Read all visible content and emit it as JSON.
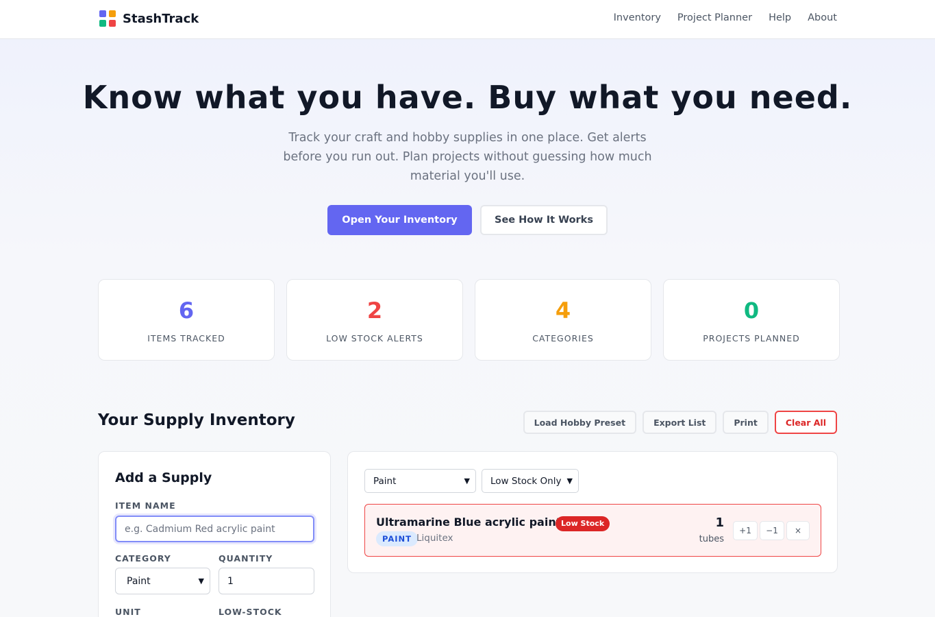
{
  "nav": {
    "brand": "StashTrack",
    "logo_colors": [
      "#6366f1",
      "#f59e0b",
      "#10b981",
      "#ef4444"
    ],
    "links": [
      "Inventory",
      "Project Planner",
      "Help",
      "About"
    ]
  },
  "hero": {
    "title": "Know what you have. Buy what you need.",
    "subtitle": "Track your craft and hobby supplies in one place. Get alerts before you run out. Plan projects without guessing how much material you'll use.",
    "primary_button": "Open Your Inventory",
    "secondary_button": "See How It Works"
  },
  "stats": [
    {
      "value": "6",
      "label": "ITEMS TRACKED",
      "color": "#6366f1"
    },
    {
      "value": "2",
      "label": "LOW STOCK ALERTS",
      "color": "#ef4444"
    },
    {
      "value": "4",
      "label": "CATEGORIES",
      "color": "#f59e0b"
    },
    {
      "value": "0",
      "label": "PROJECTS PLANNED",
      "color": "#10b981"
    }
  ],
  "inventory": {
    "title": "Your Supply Inventory",
    "actions": [
      "Load Hobby Preset",
      "Export List",
      "Print",
      "Clear All"
    ]
  },
  "add_form": {
    "title": "Add a Supply",
    "item_name_label": "ITEM NAME",
    "item_name_placeholder": "e.g. Cadmium Red acrylic paint",
    "item_name_value": "",
    "category_label": "CATEGORY",
    "category_value": "Paint",
    "quantity_label": "QUANTITY",
    "quantity_value": "1",
    "unit_label": "UNIT",
    "low_stock_label": "LOW-STOCK"
  },
  "filters": {
    "category": "Paint",
    "stock": "Low Stock Only"
  },
  "items": [
    {
      "name": "Ultramarine Blue acrylic paint",
      "status": "Low Stock",
      "category": "PAINT",
      "brand": "Liquitex",
      "quantity": "1",
      "unit": "tubes",
      "buttons": [
        "+1",
        "−1",
        "×"
      ]
    }
  ]
}
